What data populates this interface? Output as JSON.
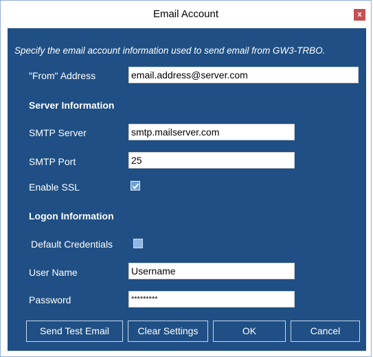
{
  "window": {
    "title": "Email Account",
    "close_label": "x"
  },
  "description": "Specify the email account information used to send email from GW3-TRBO.",
  "from_address": {
    "label": "\"From\" Address",
    "value": "email.address@server.com"
  },
  "server_section": {
    "heading": "Server Information",
    "smtp_server": {
      "label": "SMTP Server",
      "value": "smtp.mailserver.com"
    },
    "smtp_port": {
      "label": "SMTP Port",
      "value": "25"
    },
    "enable_ssl": {
      "label": "Enable SSL",
      "checked": true
    }
  },
  "logon_section": {
    "heading": "Logon Information",
    "default_credentials": {
      "label": "Default Credentials",
      "checked": false
    },
    "user_name": {
      "label": "User Name",
      "value": "Username"
    },
    "password": {
      "label": "Password",
      "value": "*********"
    }
  },
  "buttons": {
    "send_test": "Send Test Email",
    "clear": "Clear Settings",
    "ok": "OK",
    "cancel": "Cancel"
  },
  "colors": {
    "panel": "#1f4f84",
    "close": "#c75050",
    "checkbox": "#8fb7e6"
  }
}
